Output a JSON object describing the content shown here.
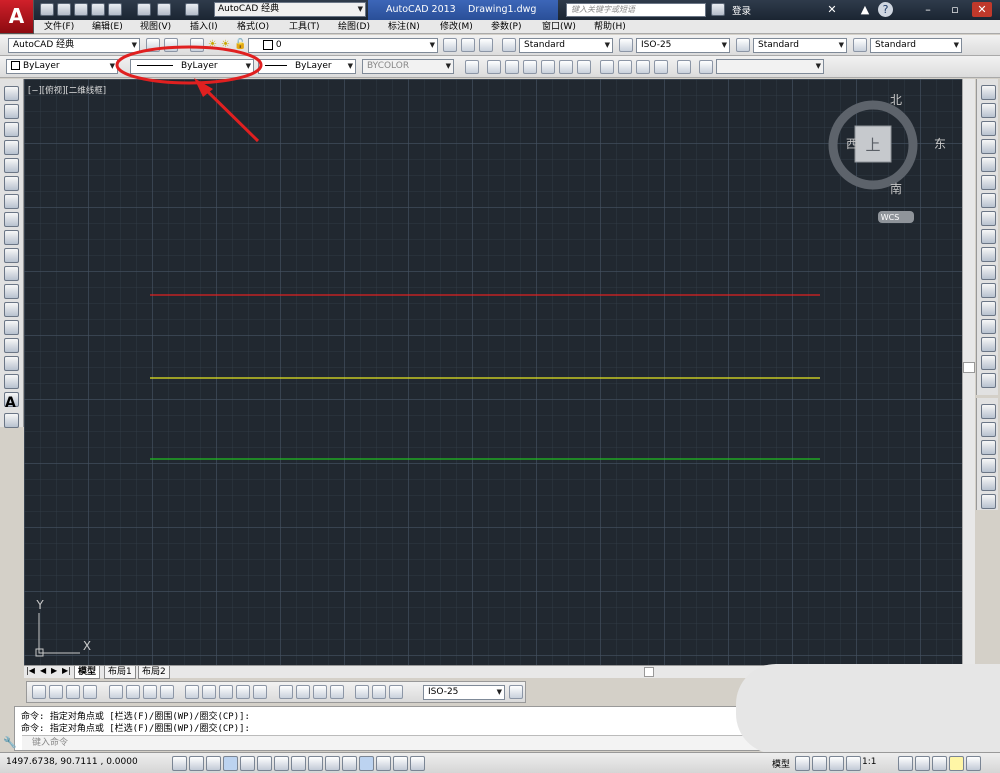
{
  "titlebar": {
    "workspace": "AutoCAD 经典",
    "app_name": "AutoCAD 2013",
    "document": "Drawing1.dwg",
    "search_placeholder": "键入关键字或短语",
    "login_label": "登录",
    "minimize": "–",
    "restore": "▫",
    "close": "✕",
    "help": "?"
  },
  "menu": [
    "文件(F)",
    "编辑(E)",
    "视图(V)",
    "插入(I)",
    "格式(O)",
    "工具(T)",
    "绘图(D)",
    "标注(N)",
    "修改(M)",
    "参数(P)",
    "窗口(W)",
    "帮助(H)"
  ],
  "toolbar1": {
    "workspace_combo": "AutoCAD 经典",
    "layer_combo": "0",
    "text_style": "Standard",
    "dim_style": "ISO-25",
    "table_style": "Standard",
    "mleader_style": "Standard"
  },
  "toolbar2": {
    "color_combo": "ByLayer",
    "linetype_combo": "ByLayer",
    "lineweight_combo": "ByLayer",
    "plotstyle_combo": "BYCOLOR"
  },
  "viewport": {
    "label": "[−][俯视][二维线框]",
    "viewcube": {
      "north": "北",
      "south": "南",
      "west": "西",
      "east": "东",
      "face": "上",
      "wcs": "WCS"
    },
    "ucs": {
      "x": "X",
      "y": "Y"
    },
    "lines": [
      {
        "color": "#e02020"
      },
      {
        "color": "#e6e620"
      },
      {
        "color": "#20c020"
      }
    ]
  },
  "tabs": [
    "模型",
    "布局1",
    "布局2"
  ],
  "dim_toolbar": {
    "style": "ISO-25"
  },
  "command": {
    "history": [
      "命令: 指定对角点或 [栏选(F)/圈围(WP)/圈交(CP)]:",
      "命令: 指定对角点或 [栏选(F)/圈围(WP)/圈交(CP)]:"
    ],
    "input_placeholder": "键入命令"
  },
  "status": {
    "coordinates": "1497.6738, 90.7111 , 0.0000",
    "model_label": "模型",
    "scale": "1:1"
  },
  "annotation_color": "#e02020"
}
